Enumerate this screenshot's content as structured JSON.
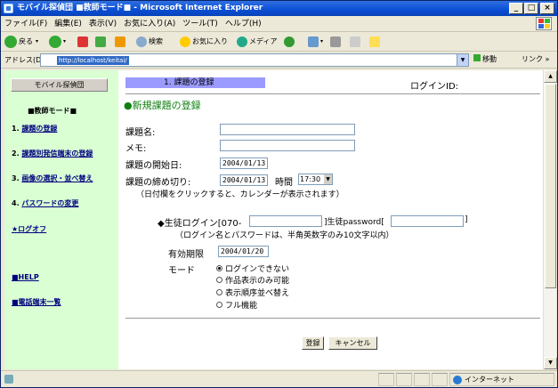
{
  "window": {
    "title": "モバイル探偵団 ■教師モード■ - Microsoft Internet Explorer",
    "controls": [
      "_",
      "□",
      "×"
    ]
  },
  "menu": [
    "ファイル(F)",
    "編集(E)",
    "表示(V)",
    "お気に入り(A)",
    "ツール(T)",
    "ヘルプ(H)"
  ],
  "toolbar": {
    "back": "戻る",
    "search": "検索",
    "favorites": "お気に入り",
    "media": "メディア"
  },
  "address": {
    "label": "アドレス(D)",
    "url": "http://localhost/keitai/",
    "go": "移動",
    "links": "リンク"
  },
  "sidebar": {
    "brand": "モバイル探偵団",
    "mode": "■教師モード■",
    "nav": [
      {
        "num": "1.",
        "label": "課題の登録"
      },
      {
        "num": "2.",
        "label": "課題別発信端末の登録"
      },
      {
        "num": "3.",
        "label": "画像の選択・並べ替え"
      },
      {
        "num": "4.",
        "label": "パスワードの変更"
      }
    ],
    "logout": "★ログオフ",
    "help": "■HELP",
    "phone": "■電話端末一覧"
  },
  "main": {
    "step": "1. 課題の登録",
    "login_label": "ログインID:",
    "section_title": "●新規課題の登録",
    "form": {
      "name_label": "課題名:",
      "memo_label": "メモ:",
      "start_label": "課題の開始日:",
      "start_value": "2004/01/13",
      "deadline_label": "課題の締め切り:",
      "deadline_value": "2004/01/13",
      "time_label": "時間",
      "time_value": "17:30",
      "date_note": "（日付欄をクリックすると、カレンダーが表示されます）"
    },
    "student": {
      "bullet": "◆",
      "login_label": "生徒ログイン[070-",
      "login_close": "]",
      "pw_label": "生徒password[",
      "pw_close": "]",
      "note": "（ログイン名とパスワードは、半角英数字のみ10文字以内）",
      "expiry_label": "有効期限",
      "expiry_value": "2004/01/20",
      "mode_label": "モード",
      "modes": [
        {
          "label": "ログインできない",
          "checked": true
        },
        {
          "label": "作品表示のみ可能",
          "checked": false
        },
        {
          "label": "表示順序並べ替え",
          "checked": false
        },
        {
          "label": "フル機能",
          "checked": false
        }
      ]
    },
    "buttons": {
      "register": "登録",
      "cancel": "キャンセル"
    }
  },
  "status": {
    "zone": "インターネット"
  }
}
